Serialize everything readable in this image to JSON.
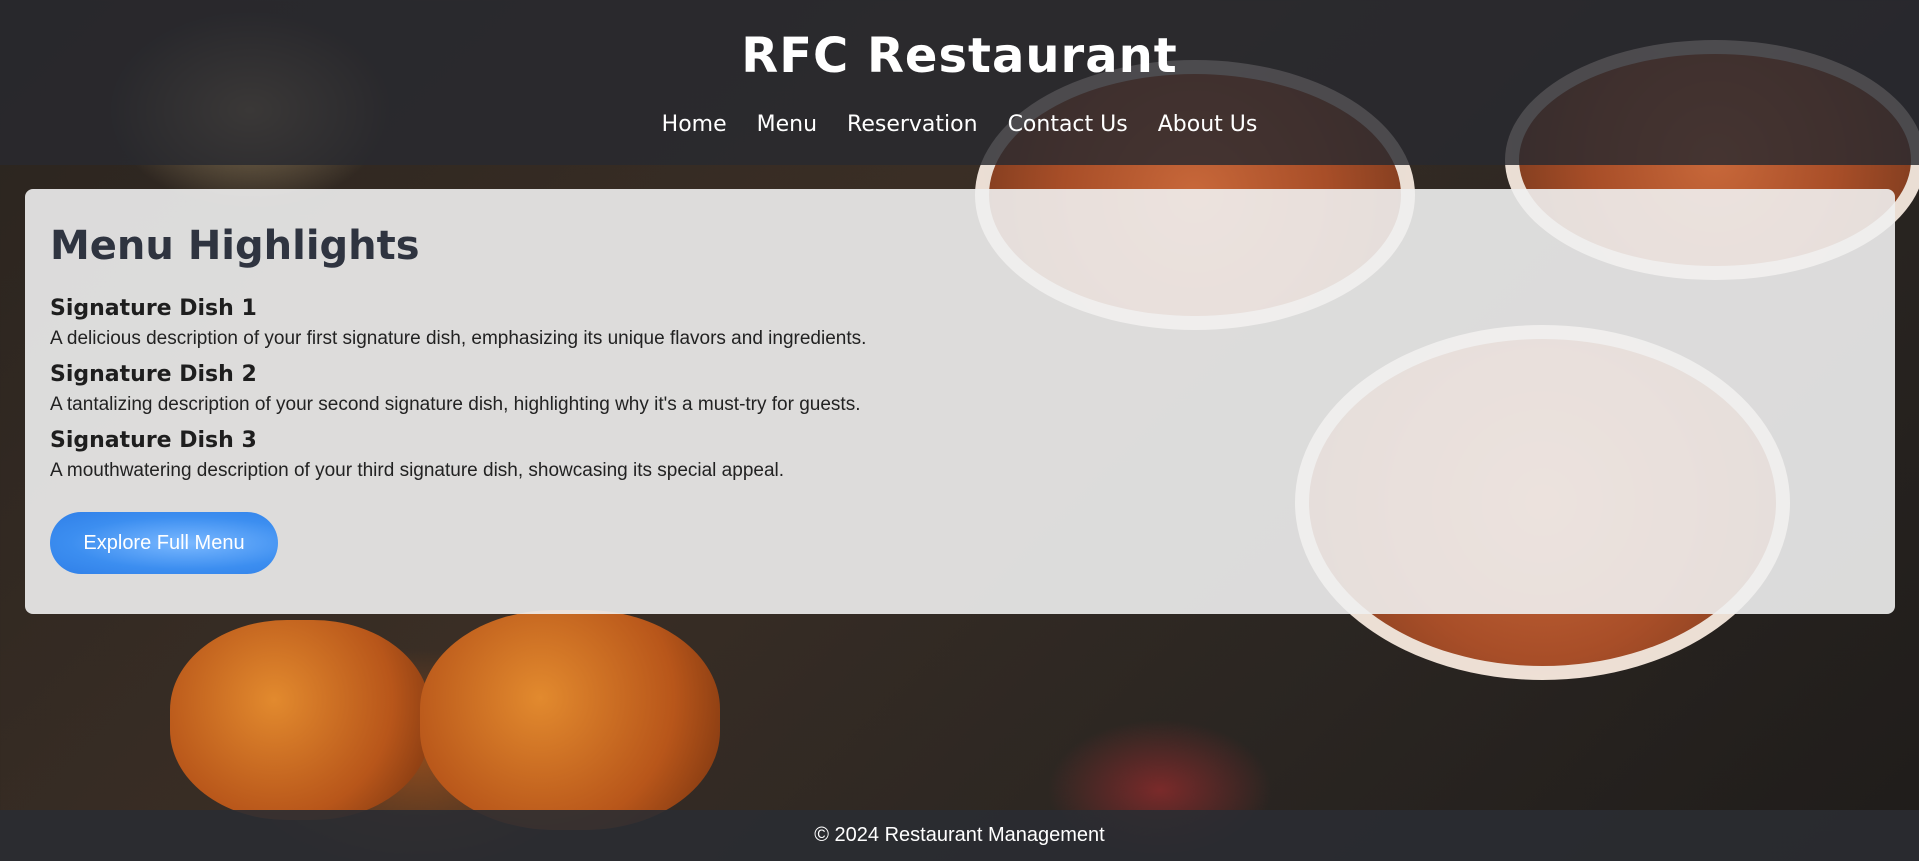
{
  "header": {
    "title": "RFC Restaurant",
    "nav": [
      "Home",
      "Menu",
      "Reservation",
      "Contact Us",
      "About Us"
    ]
  },
  "main": {
    "heading": "Menu Highlights",
    "dishes": [
      {
        "name": "Signature Dish 1",
        "description": "A delicious description of your first signature dish, emphasizing its unique flavors and ingredients."
      },
      {
        "name": "Signature Dish 2",
        "description": "A tantalizing description of your second signature dish, highlighting why it's a must-try for guests."
      },
      {
        "name": "Signature Dish 3",
        "description": "A mouthwatering description of your third signature dish, showcasing its special appeal."
      }
    ],
    "cta_label": "Explore Full Menu"
  },
  "footer": {
    "text": "© 2024 Restaurant Management"
  },
  "colors": {
    "header_bg": "#282a30",
    "card_bg": "#f0f0f0",
    "accent": "#3c8ef0"
  }
}
